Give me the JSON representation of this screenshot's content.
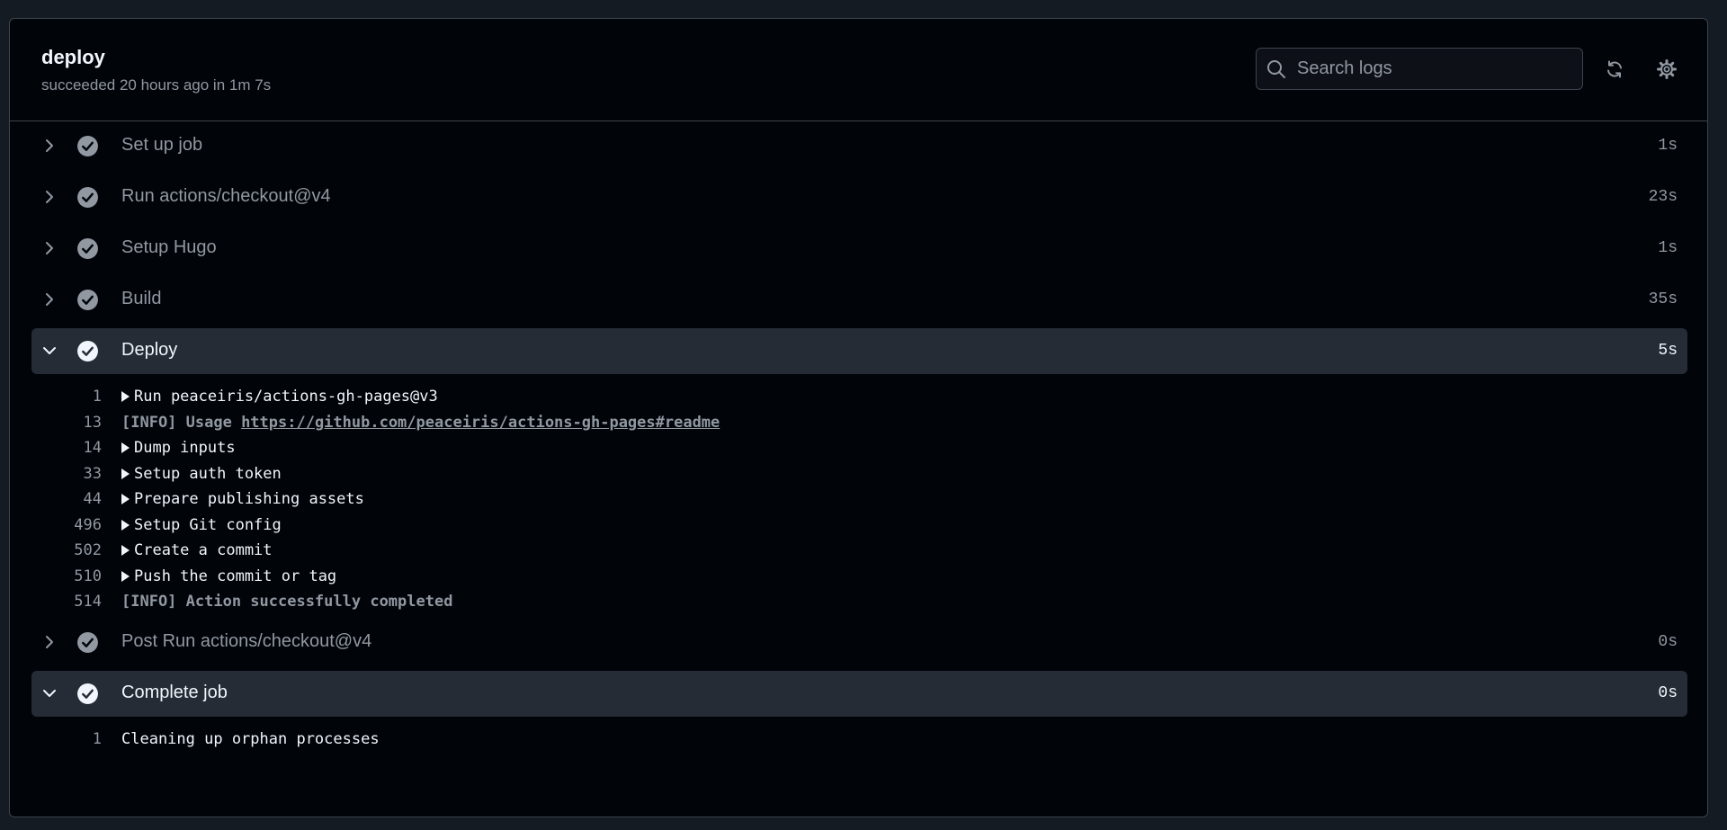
{
  "job": {
    "title": "deploy",
    "subtitle": "succeeded 20 hours ago in 1m 7s"
  },
  "search": {
    "placeholder": "Search logs"
  },
  "steps": [
    {
      "name": "Set up job",
      "duration": "1s",
      "expanded": false
    },
    {
      "name": "Run actions/checkout@v4",
      "duration": "23s",
      "expanded": false
    },
    {
      "name": "Setup Hugo",
      "duration": "1s",
      "expanded": false
    },
    {
      "name": "Build",
      "duration": "35s",
      "expanded": false
    },
    {
      "name": "Deploy",
      "duration": "5s",
      "expanded": true
    },
    {
      "name": "Post Run actions/checkout@v4",
      "duration": "0s",
      "expanded": false
    },
    {
      "name": "Complete job",
      "duration": "0s",
      "expanded": true
    }
  ],
  "deploy_log": [
    {
      "line": "1",
      "text": "Run peaceiris/actions-gh-pages@v3",
      "group": true
    },
    {
      "line": "13",
      "prefix": "[INFO] Usage ",
      "link": "https://github.com/peaceiris/actions-gh-pages#readme",
      "group": false
    },
    {
      "line": "14",
      "text": "Dump inputs",
      "group": true
    },
    {
      "line": "33",
      "text": "Setup auth token",
      "group": true
    },
    {
      "line": "44",
      "text": "Prepare publishing assets",
      "group": true
    },
    {
      "line": "496",
      "text": "Setup Git config",
      "group": true
    },
    {
      "line": "502",
      "text": "Create a commit",
      "group": true
    },
    {
      "line": "510",
      "text": "Push the commit or tag",
      "group": true
    },
    {
      "line": "514",
      "text": "[INFO] Action successfully completed",
      "group": false
    }
  ],
  "complete_log": [
    {
      "line": "1",
      "text": "Cleaning up orphan processes",
      "group": false
    }
  ],
  "icons": {
    "search": "search-icon",
    "refresh": "sync-icon",
    "settings": "gear-icon",
    "expand": "chevron-right-icon",
    "collapse": "chevron-down-icon",
    "success": "check-circle-icon"
  },
  "colors": {
    "page_bg": "#151b23",
    "panel_bg": "#010409",
    "border": "#3d444d",
    "expanded_row_bg": "#262c36",
    "text_primary": "#f0f6fc",
    "text_muted": "#9198a1"
  }
}
